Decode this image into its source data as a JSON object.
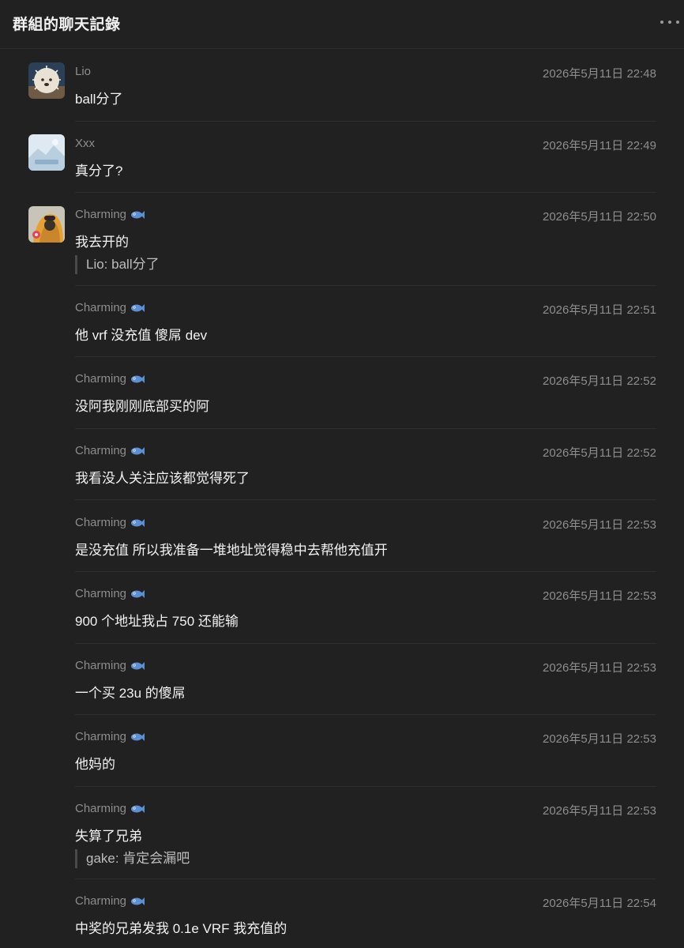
{
  "header": {
    "title": "群組的聊天記錄"
  },
  "messages": [
    {
      "author": "Lio",
      "time": "2026年5月11日 22:48",
      "text": "ball分了",
      "quote": null
    },
    {
      "author": "Xxx",
      "time": "2026年5月11日 22:49",
      "text": "真分了?",
      "quote": null
    },
    {
      "author": "Charming",
      "time": "2026年5月11日 22:50",
      "text": "我去开的",
      "quote": "Lio: ball分了"
    },
    {
      "author": "Charming",
      "time": "2026年5月11日 22:51",
      "text": "他 vrf 没充值 傻屌 dev",
      "quote": null
    },
    {
      "author": "Charming",
      "time": "2026年5月11日 22:52",
      "text": "没阿我刚刚底部买的阿",
      "quote": null
    },
    {
      "author": "Charming",
      "time": "2026年5月11日 22:52",
      "text": "我看没人关注应该都觉得死了",
      "quote": null
    },
    {
      "author": "Charming",
      "time": "2026年5月11日 22:53",
      "text": "是没充值 所以我准备一堆地址觉得稳中去帮他充值开",
      "quote": null
    },
    {
      "author": "Charming",
      "time": "2026年5月11日 22:53",
      "text": "900 个地址我占 750 还能输",
      "quote": null
    },
    {
      "author": "Charming",
      "time": "2026年5月11日 22:53",
      "text": "一个买 23u 的傻屌",
      "quote": null
    },
    {
      "author": "Charming",
      "time": "2026年5月11日 22:53",
      "text": "他妈的",
      "quote": null
    },
    {
      "author": "Charming",
      "time": "2026年5月11日 22:53",
      "text": "失算了兄弟",
      "quote": "gake: 肯定会漏吧"
    },
    {
      "author": "Charming",
      "time": "2026年5月11日 22:54",
      "text": "中奖的兄弟发我 0.1e VRF 我充值的",
      "quote": null
    }
  ],
  "icons": {
    "more": "more-horizontal-icon",
    "fish": "fish-emoji-icon"
  },
  "colors": {
    "background": "#212121",
    "text": "#f2f2f2",
    "muted": "#8d8d8d",
    "fish": "#5b8fd6"
  }
}
